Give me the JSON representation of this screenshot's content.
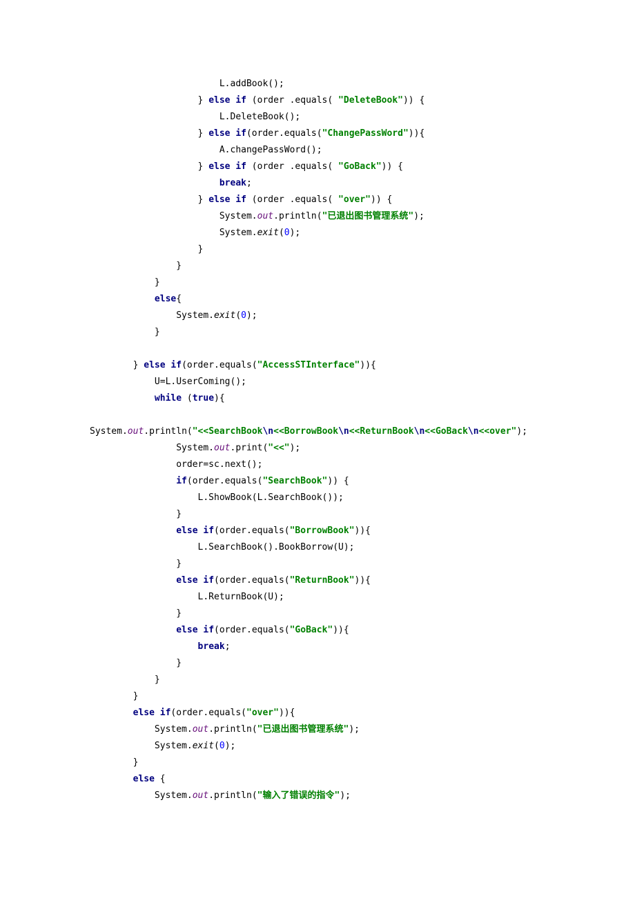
{
  "code": {
    "l1": "                        L.addBook();",
    "l2": {
      "p": "                    } ",
      "kw1": "else if",
      "p2": " (order .equals( ",
      "s": "\"DeleteBook\"",
      "p3": ")) {"
    },
    "l3": "                        L.DeleteBook();",
    "l4": {
      "p": "                    } ",
      "kw1": "else if",
      "p2": "(order.equals(",
      "s": "\"ChangePassWord\"",
      "p3": ")){"
    },
    "l5": "                        A.changePassWord();",
    "l6": {
      "p": "                    } ",
      "kw1": "else if",
      "p2": " (order .equals( ",
      "s": "\"GoBack\"",
      "p3": ")) {"
    },
    "l7": {
      "p": "                        ",
      "kw": "break",
      "p2": ";"
    },
    "l8": {
      "p": "                    } ",
      "kw1": "else if",
      "p2": " (order .equals( ",
      "s": "\"over\"",
      "p3": ")) {"
    },
    "l9": {
      "p": "                        System.",
      "f": "out",
      "p2": ".println(",
      "s": "\"已退出图书管理系统\"",
      "p3": ");"
    },
    "l10": {
      "p": "                        System.",
      "m": "exit",
      "p2": "(",
      "n": "0",
      "p3": ");"
    },
    "l11": "                    }",
    "l12": "                }",
    "l13": "            }",
    "l14": {
      "p": "            ",
      "kw": "else",
      "p2": "{"
    },
    "l15": {
      "p": "                System.",
      "m": "exit",
      "p2": "(",
      "n": "0",
      "p3": ");"
    },
    "l16": "            }",
    "l17": "",
    "l18": {
      "p": "        } ",
      "kw1": "else if",
      "p2": "(order.equals(",
      "s": "\"AccessSTInterface\"",
      "p3": ")){"
    },
    "l19": "            U=L.UserComing();",
    "l20": {
      "p": "            ",
      "kw1": "while",
      "p2": " (",
      "kw2": "true",
      "p3": "){"
    },
    "l21": "",
    "l22_pre": "System.",
    "l22_out": "out",
    "l22_p2": ".println(",
    "l22_s1": "\"<<SearchBook",
    "l22_e1": "\\n",
    "l22_s2": "<<BorrowBook",
    "l22_e2": "\\n",
    "l22_s3": "<<ReturnBook",
    "l22_e3": "\\n",
    "l22_s4": "<<GoBack",
    "l22_e4": "\\n",
    "l22_s5": "<<over\"",
    "l22_p3": ");",
    "l23": {
      "p": "                System.",
      "f": "out",
      "p2": ".print(",
      "s": "\"<<\"",
      "p3": ");"
    },
    "l24": "                order=sc.next();",
    "l25": {
      "p": "                ",
      "kw": "if",
      "p2": "(order.equals(",
      "s": "\"SearchBook\"",
      "p3": ")) {"
    },
    "l26": "                    L.ShowBook(L.SearchBook());",
    "l27": "                }",
    "l28": {
      "p": "                ",
      "kw": "else if",
      "p2": "(order.equals(",
      "s": "\"BorrowBook\"",
      "p3": ")){"
    },
    "l29": "                    L.SearchBook().BookBorrow(U);",
    "l30": "                }",
    "l31": {
      "p": "                ",
      "kw": "else if",
      "p2": "(order.equals(",
      "s": "\"ReturnBook\"",
      "p3": ")){"
    },
    "l32": "                    L.ReturnBook(U);",
    "l33": "                }",
    "l34": {
      "p": "                ",
      "kw": "else if",
      "p2": "(order.equals(",
      "s": "\"GoBack\"",
      "p3": ")){"
    },
    "l35": {
      "p": "                    ",
      "kw": "break",
      "p2": ";"
    },
    "l36": "                }",
    "l37": "            }",
    "l38": "        }",
    "l39": {
      "p": "        ",
      "kw": "else if",
      "p2": "(order.equals(",
      "s": "\"over\"",
      "p3": ")){"
    },
    "l40": {
      "p": "            System.",
      "f": "out",
      "p2": ".println(",
      "s": "\"已退出图书管理系统\"",
      "p3": ");"
    },
    "l41": {
      "p": "            System.",
      "m": "exit",
      "p2": "(",
      "n": "0",
      "p3": ");"
    },
    "l42": "        }",
    "l43": {
      "p": "        ",
      "kw": "else",
      "p2": " {"
    },
    "l44": {
      "p": "            System.",
      "f": "out",
      "p2": ".println(",
      "s": "\"输入了错误的指令\"",
      "p3": ");"
    }
  }
}
